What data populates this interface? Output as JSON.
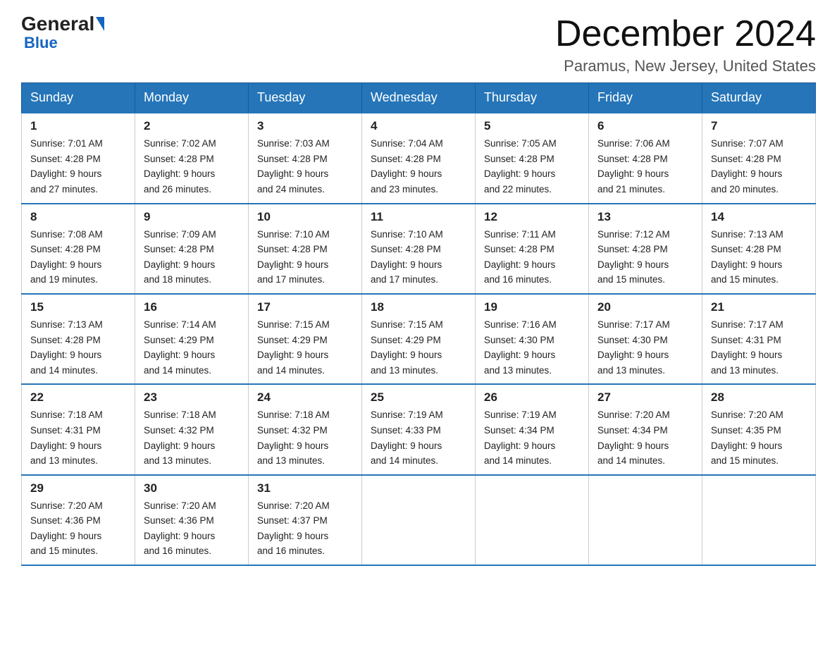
{
  "header": {
    "logo_general": "General",
    "logo_blue": "Blue",
    "month_title": "December 2024",
    "location": "Paramus, New Jersey, United States"
  },
  "days_of_week": [
    "Sunday",
    "Monday",
    "Tuesday",
    "Wednesday",
    "Thursday",
    "Friday",
    "Saturday"
  ],
  "weeks": [
    [
      {
        "num": "1",
        "sunrise": "7:01 AM",
        "sunset": "4:28 PM",
        "daylight": "9 hours and 27 minutes."
      },
      {
        "num": "2",
        "sunrise": "7:02 AM",
        "sunset": "4:28 PM",
        "daylight": "9 hours and 26 minutes."
      },
      {
        "num": "3",
        "sunrise": "7:03 AM",
        "sunset": "4:28 PM",
        "daylight": "9 hours and 24 minutes."
      },
      {
        "num": "4",
        "sunrise": "7:04 AM",
        "sunset": "4:28 PM",
        "daylight": "9 hours and 23 minutes."
      },
      {
        "num": "5",
        "sunrise": "7:05 AM",
        "sunset": "4:28 PM",
        "daylight": "9 hours and 22 minutes."
      },
      {
        "num": "6",
        "sunrise": "7:06 AM",
        "sunset": "4:28 PM",
        "daylight": "9 hours and 21 minutes."
      },
      {
        "num": "7",
        "sunrise": "7:07 AM",
        "sunset": "4:28 PM",
        "daylight": "9 hours and 20 minutes."
      }
    ],
    [
      {
        "num": "8",
        "sunrise": "7:08 AM",
        "sunset": "4:28 PM",
        "daylight": "9 hours and 19 minutes."
      },
      {
        "num": "9",
        "sunrise": "7:09 AM",
        "sunset": "4:28 PM",
        "daylight": "9 hours and 18 minutes."
      },
      {
        "num": "10",
        "sunrise": "7:10 AM",
        "sunset": "4:28 PM",
        "daylight": "9 hours and 17 minutes."
      },
      {
        "num": "11",
        "sunrise": "7:10 AM",
        "sunset": "4:28 PM",
        "daylight": "9 hours and 17 minutes."
      },
      {
        "num": "12",
        "sunrise": "7:11 AM",
        "sunset": "4:28 PM",
        "daylight": "9 hours and 16 minutes."
      },
      {
        "num": "13",
        "sunrise": "7:12 AM",
        "sunset": "4:28 PM",
        "daylight": "9 hours and 15 minutes."
      },
      {
        "num": "14",
        "sunrise": "7:13 AM",
        "sunset": "4:28 PM",
        "daylight": "9 hours and 15 minutes."
      }
    ],
    [
      {
        "num": "15",
        "sunrise": "7:13 AM",
        "sunset": "4:28 PM",
        "daylight": "9 hours and 14 minutes."
      },
      {
        "num": "16",
        "sunrise": "7:14 AM",
        "sunset": "4:29 PM",
        "daylight": "9 hours and 14 minutes."
      },
      {
        "num": "17",
        "sunrise": "7:15 AM",
        "sunset": "4:29 PM",
        "daylight": "9 hours and 14 minutes."
      },
      {
        "num": "18",
        "sunrise": "7:15 AM",
        "sunset": "4:29 PM",
        "daylight": "9 hours and 13 minutes."
      },
      {
        "num": "19",
        "sunrise": "7:16 AM",
        "sunset": "4:30 PM",
        "daylight": "9 hours and 13 minutes."
      },
      {
        "num": "20",
        "sunrise": "7:17 AM",
        "sunset": "4:30 PM",
        "daylight": "9 hours and 13 minutes."
      },
      {
        "num": "21",
        "sunrise": "7:17 AM",
        "sunset": "4:31 PM",
        "daylight": "9 hours and 13 minutes."
      }
    ],
    [
      {
        "num": "22",
        "sunrise": "7:18 AM",
        "sunset": "4:31 PM",
        "daylight": "9 hours and 13 minutes."
      },
      {
        "num": "23",
        "sunrise": "7:18 AM",
        "sunset": "4:32 PM",
        "daylight": "9 hours and 13 minutes."
      },
      {
        "num": "24",
        "sunrise": "7:18 AM",
        "sunset": "4:32 PM",
        "daylight": "9 hours and 13 minutes."
      },
      {
        "num": "25",
        "sunrise": "7:19 AM",
        "sunset": "4:33 PM",
        "daylight": "9 hours and 14 minutes."
      },
      {
        "num": "26",
        "sunrise": "7:19 AM",
        "sunset": "4:34 PM",
        "daylight": "9 hours and 14 minutes."
      },
      {
        "num": "27",
        "sunrise": "7:20 AM",
        "sunset": "4:34 PM",
        "daylight": "9 hours and 14 minutes."
      },
      {
        "num": "28",
        "sunrise": "7:20 AM",
        "sunset": "4:35 PM",
        "daylight": "9 hours and 15 minutes."
      }
    ],
    [
      {
        "num": "29",
        "sunrise": "7:20 AM",
        "sunset": "4:36 PM",
        "daylight": "9 hours and 15 minutes."
      },
      {
        "num": "30",
        "sunrise": "7:20 AM",
        "sunset": "4:36 PM",
        "daylight": "9 hours and 16 minutes."
      },
      {
        "num": "31",
        "sunrise": "7:20 AM",
        "sunset": "4:37 PM",
        "daylight": "9 hours and 16 minutes."
      },
      null,
      null,
      null,
      null
    ]
  ],
  "labels": {
    "sunrise": "Sunrise:",
    "sunset": "Sunset:",
    "daylight": "Daylight: 9 hours"
  }
}
